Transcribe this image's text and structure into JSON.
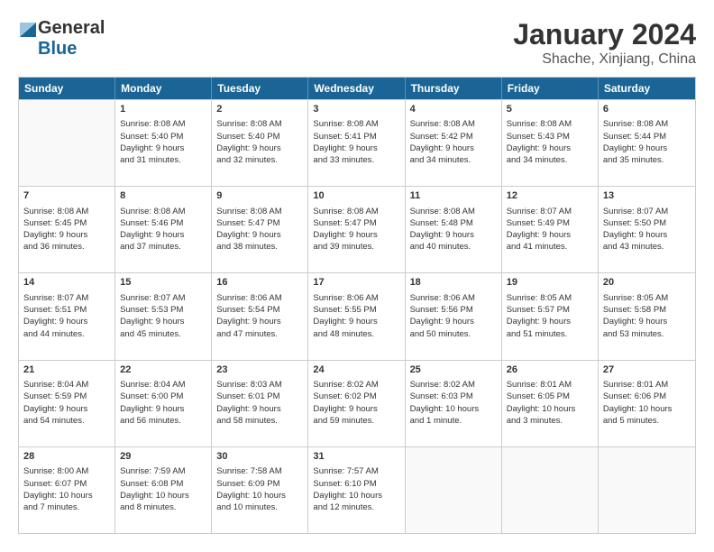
{
  "logo": {
    "general": "General",
    "blue": "Blue"
  },
  "title": "January 2024",
  "location": "Shache, Xinjiang, China",
  "weekdays": [
    "Sunday",
    "Monday",
    "Tuesday",
    "Wednesday",
    "Thursday",
    "Friday",
    "Saturday"
  ],
  "weeks": [
    [
      {
        "day": "",
        "lines": []
      },
      {
        "day": "1",
        "lines": [
          "Sunrise: 8:08 AM",
          "Sunset: 5:40 PM",
          "Daylight: 9 hours",
          "and 31 minutes."
        ]
      },
      {
        "day": "2",
        "lines": [
          "Sunrise: 8:08 AM",
          "Sunset: 5:40 PM",
          "Daylight: 9 hours",
          "and 32 minutes."
        ]
      },
      {
        "day": "3",
        "lines": [
          "Sunrise: 8:08 AM",
          "Sunset: 5:41 PM",
          "Daylight: 9 hours",
          "and 33 minutes."
        ]
      },
      {
        "day": "4",
        "lines": [
          "Sunrise: 8:08 AM",
          "Sunset: 5:42 PM",
          "Daylight: 9 hours",
          "and 34 minutes."
        ]
      },
      {
        "day": "5",
        "lines": [
          "Sunrise: 8:08 AM",
          "Sunset: 5:43 PM",
          "Daylight: 9 hours",
          "and 34 minutes."
        ]
      },
      {
        "day": "6",
        "lines": [
          "Sunrise: 8:08 AM",
          "Sunset: 5:44 PM",
          "Daylight: 9 hours",
          "and 35 minutes."
        ]
      }
    ],
    [
      {
        "day": "7",
        "lines": [
          "Sunrise: 8:08 AM",
          "Sunset: 5:45 PM",
          "Daylight: 9 hours",
          "and 36 minutes."
        ]
      },
      {
        "day": "8",
        "lines": [
          "Sunrise: 8:08 AM",
          "Sunset: 5:46 PM",
          "Daylight: 9 hours",
          "and 37 minutes."
        ]
      },
      {
        "day": "9",
        "lines": [
          "Sunrise: 8:08 AM",
          "Sunset: 5:47 PM",
          "Daylight: 9 hours",
          "and 38 minutes."
        ]
      },
      {
        "day": "10",
        "lines": [
          "Sunrise: 8:08 AM",
          "Sunset: 5:47 PM",
          "Daylight: 9 hours",
          "and 39 minutes."
        ]
      },
      {
        "day": "11",
        "lines": [
          "Sunrise: 8:08 AM",
          "Sunset: 5:48 PM",
          "Daylight: 9 hours",
          "and 40 minutes."
        ]
      },
      {
        "day": "12",
        "lines": [
          "Sunrise: 8:07 AM",
          "Sunset: 5:49 PM",
          "Daylight: 9 hours",
          "and 41 minutes."
        ]
      },
      {
        "day": "13",
        "lines": [
          "Sunrise: 8:07 AM",
          "Sunset: 5:50 PM",
          "Daylight: 9 hours",
          "and 43 minutes."
        ]
      }
    ],
    [
      {
        "day": "14",
        "lines": [
          "Sunrise: 8:07 AM",
          "Sunset: 5:51 PM",
          "Daylight: 9 hours",
          "and 44 minutes."
        ]
      },
      {
        "day": "15",
        "lines": [
          "Sunrise: 8:07 AM",
          "Sunset: 5:53 PM",
          "Daylight: 9 hours",
          "and 45 minutes."
        ]
      },
      {
        "day": "16",
        "lines": [
          "Sunrise: 8:06 AM",
          "Sunset: 5:54 PM",
          "Daylight: 9 hours",
          "and 47 minutes."
        ]
      },
      {
        "day": "17",
        "lines": [
          "Sunrise: 8:06 AM",
          "Sunset: 5:55 PM",
          "Daylight: 9 hours",
          "and 48 minutes."
        ]
      },
      {
        "day": "18",
        "lines": [
          "Sunrise: 8:06 AM",
          "Sunset: 5:56 PM",
          "Daylight: 9 hours",
          "and 50 minutes."
        ]
      },
      {
        "day": "19",
        "lines": [
          "Sunrise: 8:05 AM",
          "Sunset: 5:57 PM",
          "Daylight: 9 hours",
          "and 51 minutes."
        ]
      },
      {
        "day": "20",
        "lines": [
          "Sunrise: 8:05 AM",
          "Sunset: 5:58 PM",
          "Daylight: 9 hours",
          "and 53 minutes."
        ]
      }
    ],
    [
      {
        "day": "21",
        "lines": [
          "Sunrise: 8:04 AM",
          "Sunset: 5:59 PM",
          "Daylight: 9 hours",
          "and 54 minutes."
        ]
      },
      {
        "day": "22",
        "lines": [
          "Sunrise: 8:04 AM",
          "Sunset: 6:00 PM",
          "Daylight: 9 hours",
          "and 56 minutes."
        ]
      },
      {
        "day": "23",
        "lines": [
          "Sunrise: 8:03 AM",
          "Sunset: 6:01 PM",
          "Daylight: 9 hours",
          "and 58 minutes."
        ]
      },
      {
        "day": "24",
        "lines": [
          "Sunrise: 8:02 AM",
          "Sunset: 6:02 PM",
          "Daylight: 9 hours",
          "and 59 minutes."
        ]
      },
      {
        "day": "25",
        "lines": [
          "Sunrise: 8:02 AM",
          "Sunset: 6:03 PM",
          "Daylight: 10 hours",
          "and 1 minute."
        ]
      },
      {
        "day": "26",
        "lines": [
          "Sunrise: 8:01 AM",
          "Sunset: 6:05 PM",
          "Daylight: 10 hours",
          "and 3 minutes."
        ]
      },
      {
        "day": "27",
        "lines": [
          "Sunrise: 8:01 AM",
          "Sunset: 6:06 PM",
          "Daylight: 10 hours",
          "and 5 minutes."
        ]
      }
    ],
    [
      {
        "day": "28",
        "lines": [
          "Sunrise: 8:00 AM",
          "Sunset: 6:07 PM",
          "Daylight: 10 hours",
          "and 7 minutes."
        ]
      },
      {
        "day": "29",
        "lines": [
          "Sunrise: 7:59 AM",
          "Sunset: 6:08 PM",
          "Daylight: 10 hours",
          "and 8 minutes."
        ]
      },
      {
        "day": "30",
        "lines": [
          "Sunrise: 7:58 AM",
          "Sunset: 6:09 PM",
          "Daylight: 10 hours",
          "and 10 minutes."
        ]
      },
      {
        "day": "31",
        "lines": [
          "Sunrise: 7:57 AM",
          "Sunset: 6:10 PM",
          "Daylight: 10 hours",
          "and 12 minutes."
        ]
      },
      {
        "day": "",
        "lines": []
      },
      {
        "day": "",
        "lines": []
      },
      {
        "day": "",
        "lines": []
      }
    ]
  ]
}
